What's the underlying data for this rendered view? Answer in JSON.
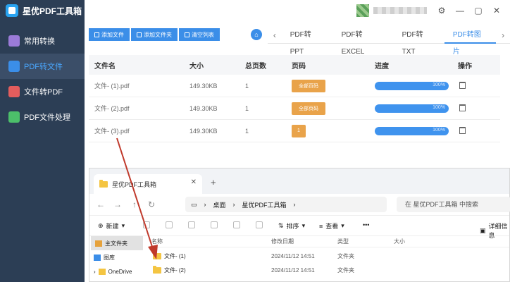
{
  "app": {
    "name": "星优PDF工具箱"
  },
  "sidebar": {
    "items": [
      {
        "label": "常用转换",
        "color": "#9b7bd8",
        "active": false
      },
      {
        "label": "PDF转文件",
        "color": "#3b8ee8",
        "active": true
      },
      {
        "label": "文件转PDF",
        "color": "#e35d5d",
        "active": false
      },
      {
        "label": "PDF文件处理",
        "color": "#4cbf6a",
        "active": false
      }
    ]
  },
  "window_controls": {
    "settings": "⚙",
    "minimize": "—",
    "maximize": "▢",
    "close": "✕"
  },
  "toolbar": {
    "add_file": "添加文件",
    "add_folder": "添加文件夹",
    "clear_list": "清空列表"
  },
  "tabs": [
    {
      "label": "PDF转PPT",
      "active": false
    },
    {
      "label": "PDF转EXCEL",
      "active": false
    },
    {
      "label": "PDF转TXT",
      "active": false
    },
    {
      "label": "PDF转图片",
      "active": true
    }
  ],
  "table": {
    "headers": [
      "文件名",
      "大小",
      "总页数",
      "页码",
      "进度",
      "操作"
    ],
    "rows": [
      {
        "name": "文件- (1).pdf",
        "size": "149.30KB",
        "pages": "1",
        "page_range": "全部页码",
        "progress_label": "100%",
        "progress": 1.0
      },
      {
        "name": "文件- (2).pdf",
        "size": "149.30KB",
        "pages": "1",
        "page_range": "全部页码",
        "progress_label": "100%",
        "progress": 1.0
      },
      {
        "name": "文件- (3).pdf",
        "size": "149.30KB",
        "pages": "1",
        "page_range": "1",
        "progress_label": "100%",
        "progress": 1.0
      }
    ]
  },
  "explorer": {
    "tab_title": "星优PDF工具箱",
    "tab_close": "✕",
    "new_tab": "+",
    "breadcrumb": [
      "桌面",
      "星优PDF工具箱"
    ],
    "search_placeholder": "在 星优PDF工具箱 中搜索",
    "new_label": "新建",
    "sort_label": "排序",
    "view_label": "查看",
    "more_label": "•••",
    "details_label": "详细信息",
    "nav_pane": [
      "主文件夹",
      "图库",
      "OneDrive"
    ],
    "columns": [
      "名称",
      "修改日期",
      "类型",
      "大小"
    ],
    "files": [
      {
        "name": "文件- (1)",
        "date": "2024/11/12 14:51",
        "type": "文件夹"
      },
      {
        "name": "文件- (2)",
        "date": "2024/11/12 14:51",
        "type": "文件夹"
      }
    ]
  }
}
